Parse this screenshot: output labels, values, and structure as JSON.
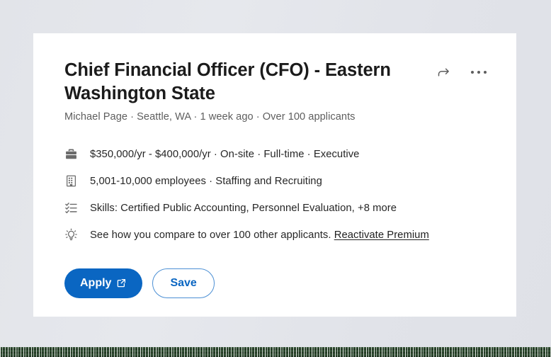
{
  "job": {
    "title": "Chief Financial Officer (CFO) - Eastern Washington State",
    "meta": "Michael Page · Seattle, WA · 1 week ago · Over 100 applicants",
    "details": [
      {
        "icon": "briefcase-icon",
        "text": "$350,000/yr - $400,000/yr · On-site · Full-time · Executive"
      },
      {
        "icon": "building-icon",
        "text": "5,001-10,000 employees · Staffing and Recruiting"
      },
      {
        "icon": "skills-checklist-icon",
        "text": "Skills: Certified Public Accounting, Personnel Evaluation, +8 more"
      },
      {
        "icon": "lightbulb-icon",
        "text": "See how you compare to over 100 other applicants.",
        "link": "Reactivate Premium"
      }
    ],
    "actions": {
      "apply_label": "Apply",
      "apply_icon": "external-link-icon",
      "save_label": "Save",
      "share_icon": "share-arrow-icon",
      "more_icon": "more-options-icon"
    }
  },
  "colors": {
    "accent_blue": "#0a66c2",
    "save_border": "#4b8fd4",
    "page_background": "#e3e5ea",
    "card_background": "#ffffff",
    "title_text": "#1b1b1b",
    "meta_text": "#5e5e5e",
    "icon_gray": "#6b6b6b",
    "band_green": "#2d4a2f"
  }
}
